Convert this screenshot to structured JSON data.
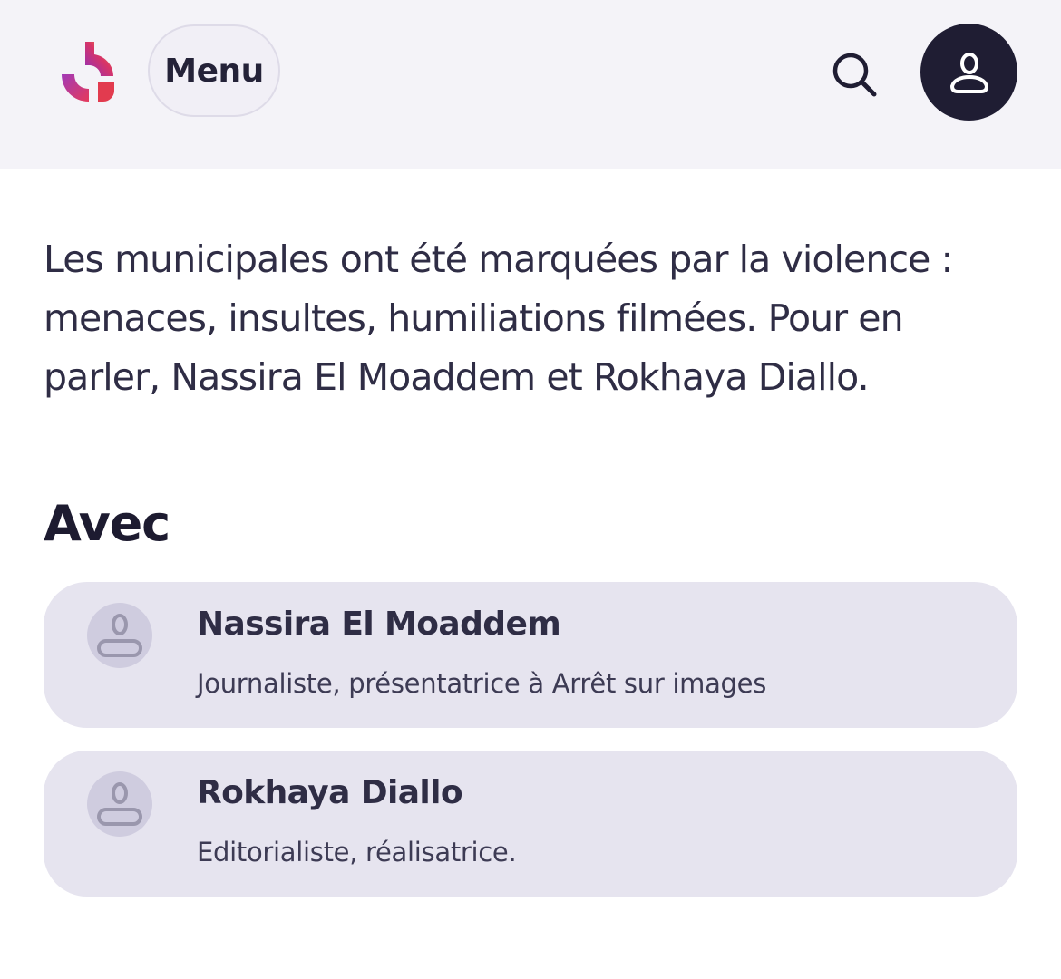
{
  "header": {
    "logo_icon": "brand-logo-icon",
    "menu_label": "Menu",
    "search_icon": "search-icon",
    "account_icon": "user-icon"
  },
  "main": {
    "intro": "Les municipales ont été marquées par la violence : menaces, insultes, humiliations filmées. Pour en parler, Nassira El Moaddem et Rokhaya Diallo.",
    "section_title": "Avec",
    "people": [
      {
        "name": "Nassira El Moaddem",
        "role": "Journaliste, présentatrice à Arrêt sur images",
        "avatar_icon": "user-placeholder-icon"
      },
      {
        "name": "Rokhaya Diallo",
        "role": "Editorialiste, réalisatrice.",
        "avatar_icon": "user-placeholder-icon"
      }
    ]
  },
  "colors": {
    "header_bg": "#f4f3f8",
    "card_bg": "#e6e4ef",
    "account_bg": "#1f1d33",
    "text_dark": "#2f2d45",
    "logo_gradient": [
      "#8b2fc0",
      "#e0345a",
      "#f59a3a"
    ]
  }
}
